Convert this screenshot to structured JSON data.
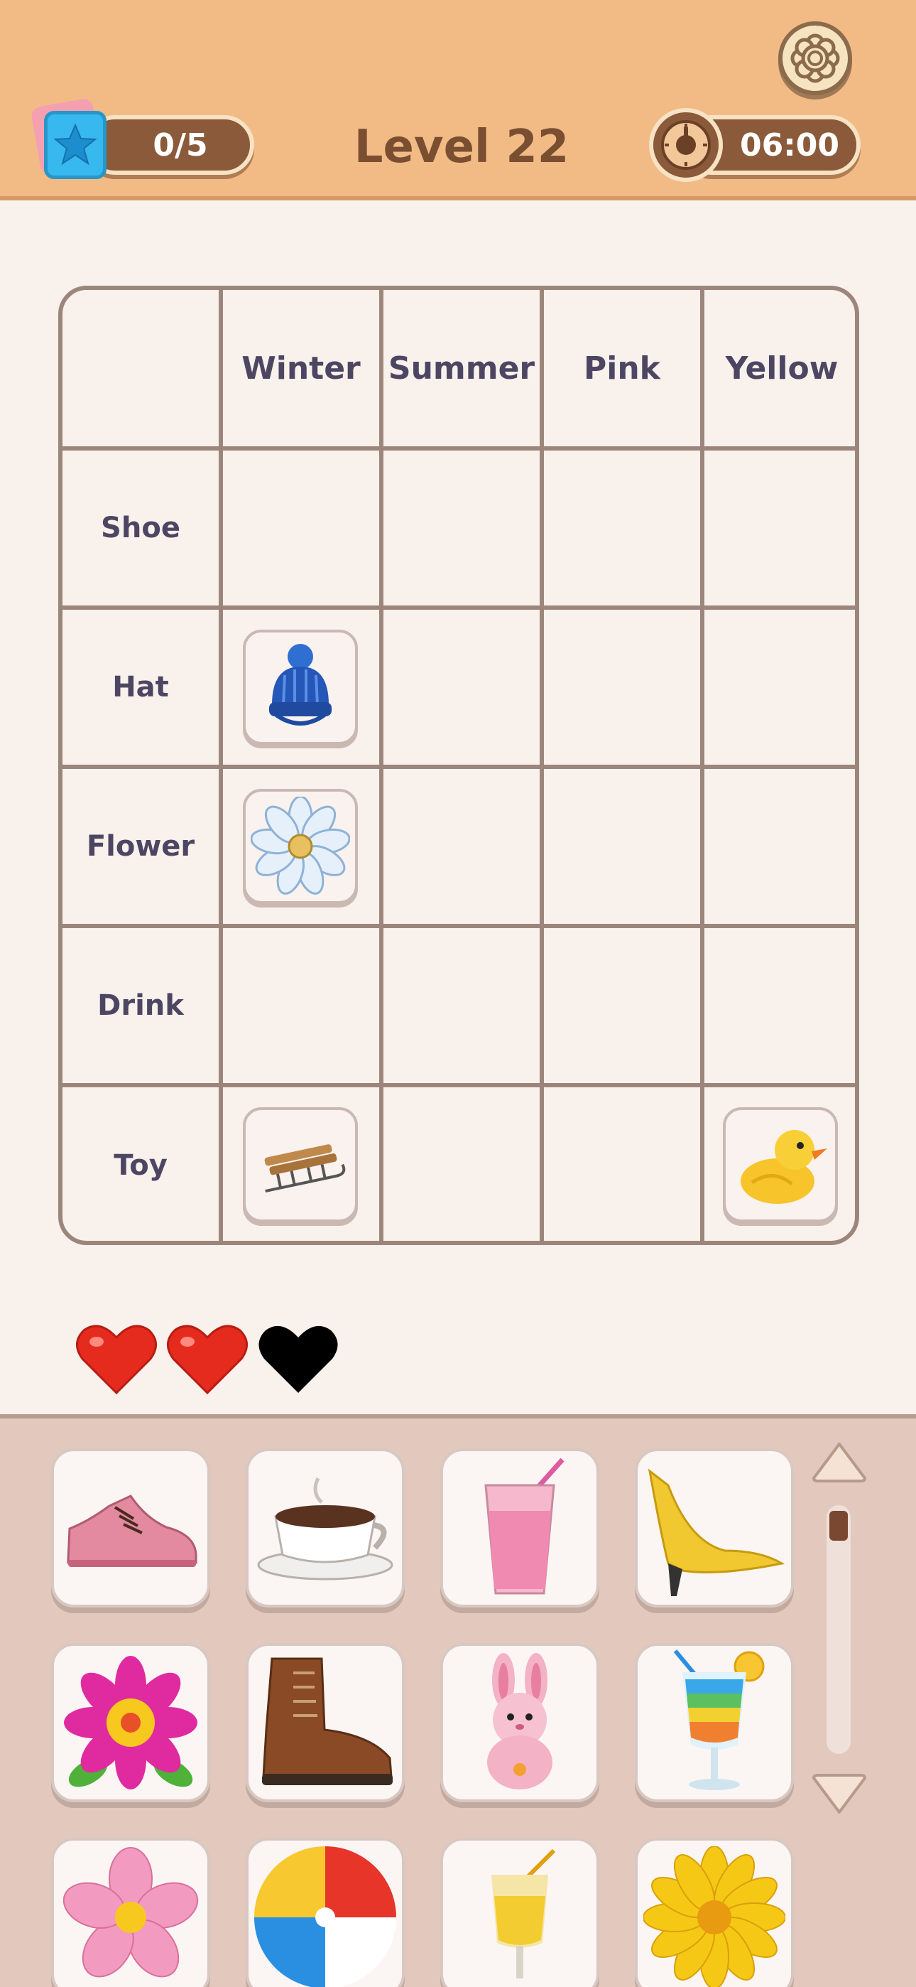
{
  "header": {
    "level_title": "Level 22",
    "stars_progress": "0/5",
    "timer": "06:00"
  },
  "grid": {
    "columns": [
      "Winter",
      "Summer",
      "Pink",
      "Yellow"
    ],
    "rows": [
      "Shoe",
      "Hat",
      "Flower",
      "Drink",
      "Toy"
    ],
    "placed": [
      {
        "row": "Hat",
        "column": "Winter",
        "item": "blue knit beanie"
      },
      {
        "row": "Flower",
        "column": "Winter",
        "item": "frosty white flower"
      },
      {
        "row": "Toy",
        "column": "Winter",
        "item": "wooden sled"
      },
      {
        "row": "Toy",
        "column": "Yellow",
        "item": "yellow rubber duck"
      }
    ]
  },
  "lives": {
    "total": 3,
    "remaining": 2
  },
  "tray": {
    "items": [
      "pink lace-up shoe",
      "hot coffee cup",
      "pink drink with straw",
      "yellow high heel",
      "magenta and yellow flower",
      "brown winter boot",
      "pink bunny plush",
      "rainbow cocktail",
      "pink flower",
      "beach ball",
      "lemonade glass",
      "yellow flower"
    ]
  },
  "colors": {
    "header_bg": "#f2bb86",
    "page_bg": "#f9f1ec",
    "grid_line": "#9c867c",
    "label_text": "#4d4663",
    "title_text": "#7a4e30",
    "pill_bg": "#8a5a3a",
    "heart_full": "#e52b1e",
    "heart_lost": "#000000",
    "tray_bg": "#e3c8bd"
  }
}
